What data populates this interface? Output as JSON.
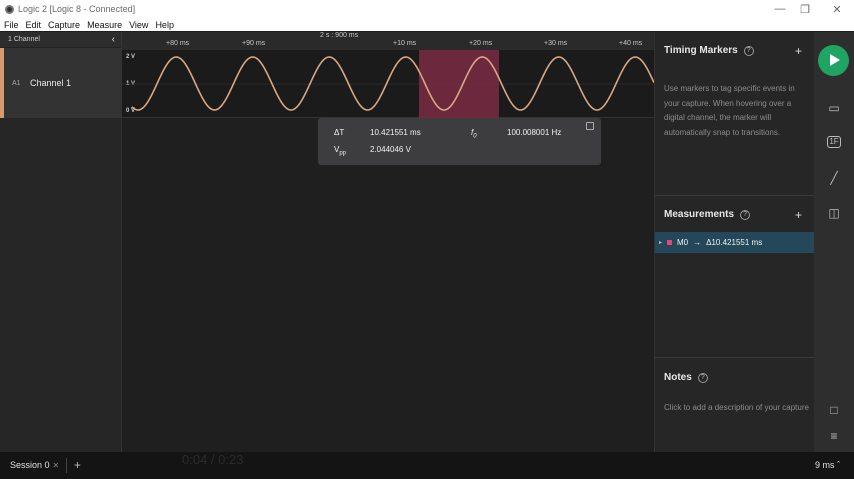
{
  "window": {
    "title": "Logic 2 [Logic 8 - Connected]"
  },
  "menu": [
    "File",
    "Edit",
    "Capture",
    "Measure",
    "View",
    "Help"
  ],
  "channels_panel": {
    "header": "1 Channel",
    "channel": {
      "id": "A1",
      "name": "Channel 1"
    }
  },
  "ruler": {
    "center_label": "2 s : 900 ms",
    "ticks": [
      "+80 ms",
      "+90 ms",
      "+10 ms",
      "+20 ms",
      "+30 ms",
      "+40 ms"
    ]
  },
  "waveform": {
    "voltage_labels": [
      "2 V",
      "1 V",
      "0 V"
    ],
    "trace_color": "#d8a882",
    "highlight_color": "#7a2a42"
  },
  "measurement_tooltip": {
    "dt_label": "ΔT",
    "dt_value": "10.421551 ms",
    "f_label": "f",
    "f_sub": "0",
    "f_value": "100.008001 Hz",
    "vpp_label": "V",
    "vpp_sub": "pp",
    "vpp_value": "2.044046 V"
  },
  "timing_markers": {
    "title": "Timing Markers",
    "description": "Use markers to tag specific events in your capture. When hovering over a digital channel, the marker will automatically snap to transitions."
  },
  "measurements": {
    "title": "Measurements",
    "items": [
      {
        "id": "M0",
        "value": "Δ10.421551 ms",
        "color": "#e2467a"
      }
    ]
  },
  "notes": {
    "title": "Notes",
    "placeholder": "Click to add a description of your capture"
  },
  "bottom": {
    "session_tab": "Session 0",
    "zoom": "9 ms",
    "ghost_time": "0:04 / 0:23"
  },
  "icons": {
    "start": "play-icon",
    "device": "device-icon",
    "analyzer": "analyzer-icon",
    "ruler": "ruler-icon",
    "extensions": "extensions-icon",
    "comment": "comment-icon",
    "menu": "menu-icon"
  },
  "colors": {
    "accent_green": "#1fa463",
    "selection_blue": "#24475a",
    "channel_orange": "#d59a72"
  }
}
